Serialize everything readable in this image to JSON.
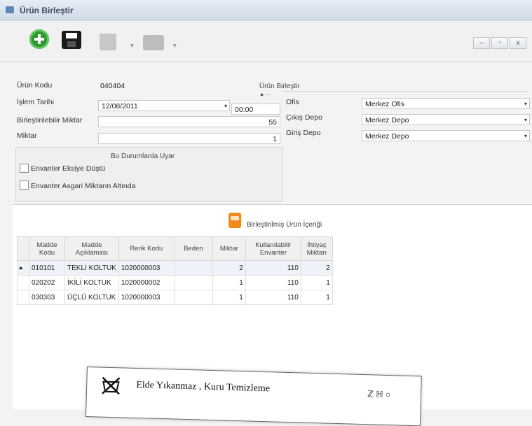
{
  "window": {
    "title": "Ürün Birleştir"
  },
  "window_buttons": [
    "–",
    "▫",
    "x"
  ],
  "form": {
    "urun_kodu_label": "Ürün Kodu",
    "urun_kodu_value": "040404",
    "islem_tarihi_label": "İşlem Tarihi",
    "islem_tarihi_value": "12/08/2011",
    "islem_saati_value": "00:00",
    "birlestirilebilir_label": "Birleştirilebilir Miktar",
    "birlestirilebilir_value": "55",
    "miktar_label": "Miktar",
    "miktar_value": "1",
    "urun_birlestir_title": "Ürün Birleştir",
    "ofis_label": "Ofis",
    "ofis_value": "Merkez Ofis",
    "cikis_depo_label": "Çıkış Depo",
    "cikis_depo_value": "Merkez Depo",
    "giris_depo_label": "Giriş Depo",
    "giris_depo_value": "Merkez Depo",
    "lookup_buttons": "▸ ···"
  },
  "warnings": {
    "title": "Bu Durumlarda Uyar",
    "items": [
      {
        "label": "Envanter Eksiye Düştü",
        "checked": false
      },
      {
        "label": "Envanter Asgari Miktarın Altında",
        "checked": false
      }
    ]
  },
  "contents": {
    "title": "Birleştirilmiş Ürün İçeriği",
    "columns": [
      "Madde Kodu",
      "Madde Açıklaması",
      "Renk Kodu",
      "Beden",
      "Miktar",
      "Kullanılabilir Envanter",
      "İhtiyaç Miktarı"
    ],
    "rows": [
      {
        "code": "010101",
        "desc": "TEKLİ KOLTUK",
        "renk": "1020000003",
        "beden": "",
        "miktar": "2",
        "envanter": "110",
        "ihtiyac": "2"
      },
      {
        "code": "020202",
        "desc": "İKİLİ KOLTUK",
        "renk": "1020000002",
        "beden": "",
        "miktar": "1",
        "envanter": "110",
        "ihtiyac": "1"
      },
      {
        "code": "030303",
        "desc": "ÜÇLÜ KOLTUK",
        "renk": "1020000003",
        "beden": "",
        "miktar": "1",
        "envanter": "110",
        "ihtiyac": "1"
      }
    ]
  },
  "care_label": {
    "text": "Elde Yıkanmaz , Kuru Temizleme",
    "extra": "ℤ ℍ ○"
  },
  "colors": {
    "accent_orange": "#f08a1e",
    "add_green": "#2e9a2e",
    "titlebar": "#cfd9e6"
  }
}
